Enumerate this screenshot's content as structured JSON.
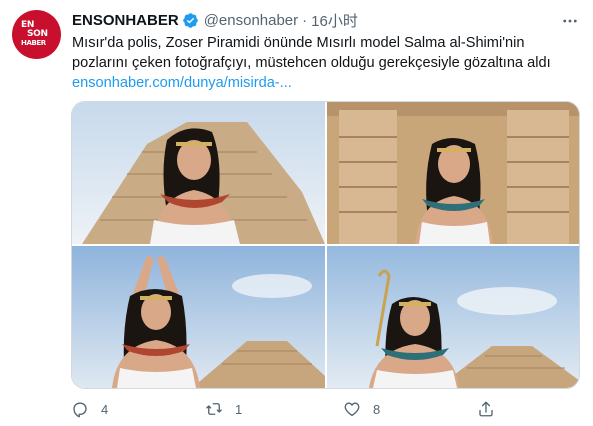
{
  "tweet": {
    "author_name": "ENSONHABER",
    "author_handle": "@ensonhaber",
    "separator": "·",
    "time": "16小时",
    "avatar_logo": [
      "EN",
      "SON",
      "HABER"
    ],
    "text": "Mısır'da polis, Zoser Piramidi önünde Mısırlı model Salma al-Shimi'nin pozlarını çeken fotoğrafçıyı, müstehcen olduğu gerekçesiyle gözaltına aldı",
    "link": "ensonhaber.com/dunya/misirda-..."
  },
  "media": {
    "photos": [
      {
        "name": "photo-1",
        "description": "model-in-front-of-pyramid"
      },
      {
        "name": "photo-2",
        "description": "model-between-temple-columns"
      },
      {
        "name": "photo-3",
        "description": "model-arms-raised-pyramid"
      },
      {
        "name": "photo-4",
        "description": "model-holding-staff-pyramid"
      }
    ]
  },
  "actions": {
    "reply_count": "4",
    "retweet_count": "1",
    "like_count": "8"
  },
  "icons": {
    "verified": "verified-badge-icon",
    "more": "more-options-icon",
    "reply": "reply-icon",
    "retweet": "retweet-icon",
    "like": "like-icon",
    "share": "share-icon"
  },
  "colors": {
    "link": "#1d9bf0",
    "secondary_text": "#536471",
    "verified": "#1d9bf0",
    "avatar_bg": "#c8102e"
  }
}
